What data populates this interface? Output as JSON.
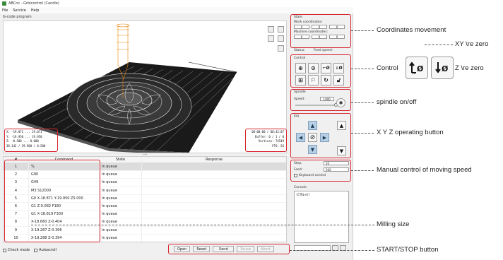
{
  "window": {
    "title": "ABCnc - Grblcontrol (Candle)",
    "menu": [
      "File",
      "Service",
      "Help"
    ]
  },
  "gcode_label": "G-code program",
  "viewport_info": {
    "left_lines": [
      "X: -19.071 ... 19.071",
      "Y: -19.950 ... 19.950",
      "Z: -0.500 ... 0.000",
      "38.142 / 39.900 / 0.500"
    ],
    "right_lines": [
      "00:00:00 / 00:42:07",
      "Buffer: 0 / 1 / 0",
      "Vertices: 74549",
      "FPS: 56"
    ]
  },
  "table": {
    "headers": [
      "#",
      "Command",
      "State",
      "Response"
    ],
    "rows": [
      {
        "num": "1",
        "cmd": "%",
        "state": "In queue",
        "resp": ""
      },
      {
        "num": "2",
        "cmd": "G90",
        "state": "In queue",
        "resp": ""
      },
      {
        "num": "3",
        "cmd": "G49",
        "state": "In queue",
        "resp": ""
      },
      {
        "num": "4",
        "cmd": "M3 S12000",
        "state": "In queue",
        "resp": ""
      },
      {
        "num": "5",
        "cmd": "G0 X-18.871 Y-19.950 Z5.000",
        "state": "In queue",
        "resp": ""
      },
      {
        "num": "6",
        "cmd": "G1  Z-0.082 F180",
        "state": "In queue",
        "resp": ""
      },
      {
        "num": "7",
        "cmd": "G1 X-18.819  F300",
        "state": "In queue",
        "resp": ""
      },
      {
        "num": "8",
        "cmd": "X-18.660  Z-0.404",
        "state": "In queue",
        "resp": ""
      },
      {
        "num": "9",
        "cmd": "X-19.287  Z-0.396",
        "state": "In queue",
        "resp": ""
      },
      {
        "num": "10",
        "cmd": "X-19.288  Z-0.394",
        "state": "In queue",
        "resp": ""
      }
    ]
  },
  "bottom": {
    "check_mode": "Check mode",
    "autoscroll": "Autoscroll",
    "buttons": [
      "Open",
      "Reset",
      "Send",
      "Pause",
      "Abort"
    ]
  },
  "state_panel": {
    "title": "State",
    "work_label": "Work coordinates:",
    "machine_label": "Machine coordinates:",
    "work_values": [
      "0",
      "0",
      "0"
    ],
    "machine_values": [
      "0",
      "0",
      "0"
    ],
    "status_label": "Status:",
    "feed_speed_label": "Feed speed:"
  },
  "control_panel": {
    "title": "Control"
  },
  "spindle_panel": {
    "title": "Spindle",
    "speed_label": "Speed:",
    "speed_value": "1000"
  },
  "jog_panel": {
    "title": "Jog"
  },
  "feed_panel": {
    "step_label": "Step:",
    "step_value": "10",
    "feed_label": "Feed:",
    "feed_value": "500",
    "keyboard_control": "Keyboard control"
  },
  "console": {
    "title": "Console",
    "text": "[CTRL+X]"
  },
  "annotations": {
    "coordinates": "Coordinates movement",
    "control": "Control",
    "spindle": "spindle  on/off",
    "jog": "X Y Z operating button",
    "speed": "Manual control of moving speed",
    "milling": "Milling size",
    "startstop": "START/STOP button",
    "xy_zero": "XY \\re zero",
    "z_zero": "Z \\re zero"
  },
  "colors": {
    "callout": "#d6262e",
    "jog_blue": "#b8cfe4",
    "accent_green": "#3c8a3c"
  }
}
